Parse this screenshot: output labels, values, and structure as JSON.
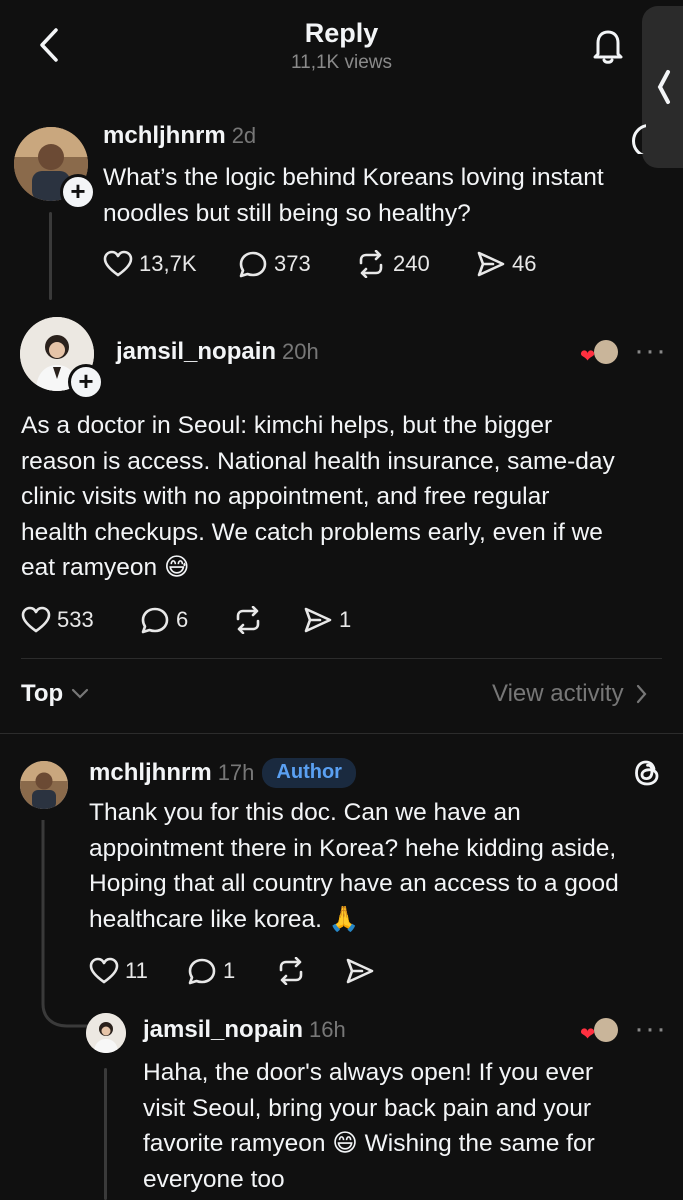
{
  "header": {
    "title": "Reply",
    "views": "11,1K views"
  },
  "original_post": {
    "username": "mchljhnrm",
    "time": "2d",
    "text_line1": "What’s the logic behind Koreans loving instant",
    "text_line2": "noodles but still being so healthy?",
    "likes": "13,7K",
    "comments": "373",
    "reposts": "240",
    "shares": "46"
  },
  "focused_reply": {
    "username": "jamsil_nopain",
    "time": "20h",
    "lines": [
      "As a doctor in Seoul: kimchi helps, but the bigger",
      "reason is access. National health insurance, same-day",
      "clinic visits with no appointment, and free regular",
      "health checkups. We catch problems early, even if we",
      "eat ramyeon 😅"
    ],
    "likes": "533",
    "comments": "6",
    "shares": "1"
  },
  "sort_bar": {
    "sort_label": "Top",
    "activity_label": "View activity"
  },
  "comment1": {
    "username": "mchljhnrm",
    "time": "17h",
    "badge": "Author",
    "lines": [
      "Thank you for this doc. Can we have an",
      "appointment there in Korea? hehe kidding aside,",
      "Hoping that all country have an access to a good",
      "healthcare like korea. 🙏"
    ],
    "likes": "11",
    "comments": "1"
  },
  "comment2": {
    "username": "jamsil_nopain",
    "time": "16h",
    "lines": [
      "Haha, the door's always open! If you ever",
      "visit Seoul, bring your back pain and your",
      "favorite ramyeon 😄 Wishing the same for",
      "everyone too"
    ]
  },
  "colors": {
    "background": "#101010",
    "text": "#f3f5f7",
    "muted": "#777777",
    "author_badge_text": "#5aa0f2",
    "like_heart": "#ff3040"
  }
}
